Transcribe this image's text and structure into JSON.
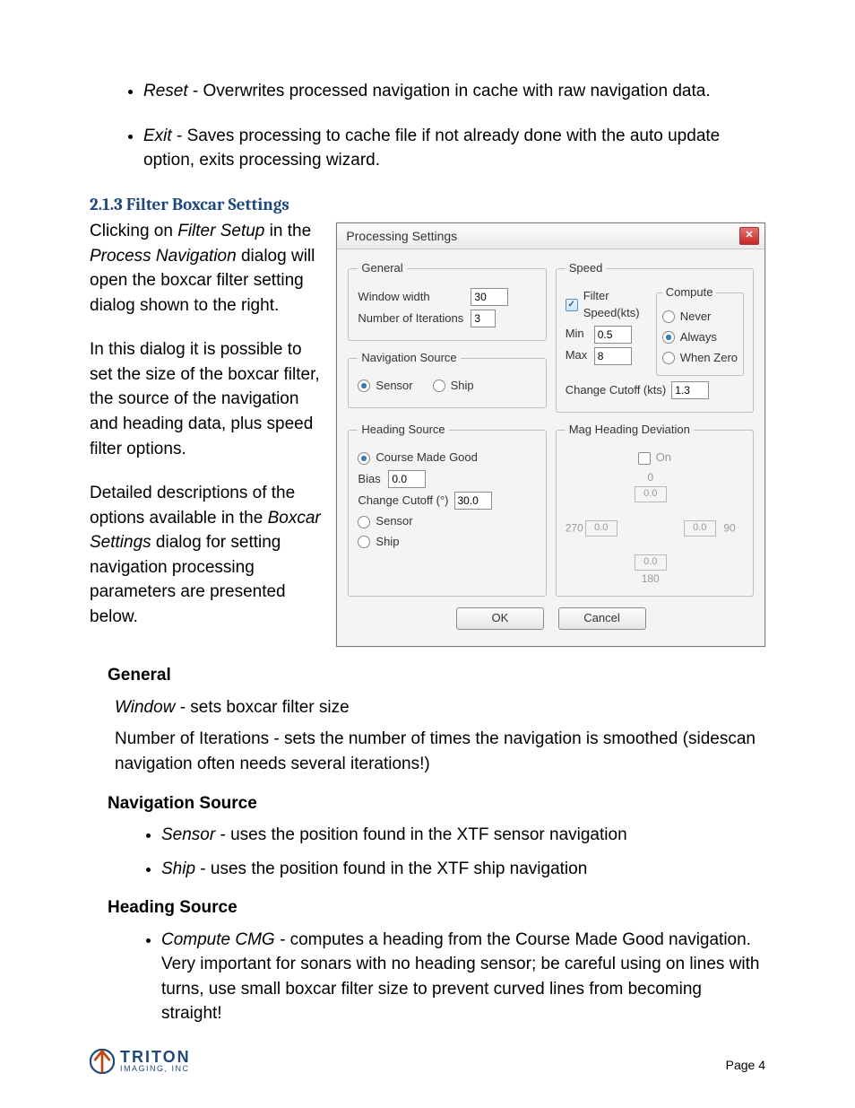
{
  "bullets_top": [
    {
      "term": "Reset",
      "desc": " - Overwrites processed navigation in cache with raw navigation data."
    },
    {
      "term": "Exit",
      "desc": " - Saves processing to cache file if not already done with the auto update option, exits processing wizard."
    }
  ],
  "section_number": "2.1.3 Filter Boxcar Settings",
  "para1a": "Clicking on ",
  "para1b": "Filter Setup",
  "para1c": " in the ",
  "para1d": "Process Navigation",
  "para1e": " dialog will open the boxcar filter setting dialog shown to the right.",
  "para2": "In this dialog it is possible to set the size of the boxcar filter, the source of the navigation and heading data, plus speed filter options.",
  "para3a": "Detailed descriptions of the options available in the ",
  "para3b": "Boxcar Settings",
  "para3c": " dialog for setting navigation processing parameters are presented below.",
  "dialog": {
    "title": "Processing Settings",
    "general": {
      "legend": "General",
      "window_label": "Window width",
      "window_value": "30",
      "iter_label": "Number of Iterations",
      "iter_value": "3"
    },
    "navsource": {
      "legend": "Navigation Source",
      "sensor": "Sensor",
      "ship": "Ship"
    },
    "speed": {
      "legend": "Speed",
      "filter_label": "Filter Speed(kts)",
      "min_label": "Min",
      "min_value": "0.5",
      "max_label": "Max",
      "max_value": "8",
      "cutoff_label": "Change Cutoff (kts)",
      "cutoff_value": "1.3",
      "compute": {
        "legend": "Compute",
        "never": "Never",
        "always": "Always",
        "whenzero": "When Zero"
      }
    },
    "heading": {
      "legend": "Heading Source",
      "cmg": "Course Made Good",
      "bias_label": "Bias",
      "bias_value": "0.0",
      "cutoff_label": "Change Cutoff (°)",
      "cutoff_value": "30.0",
      "sensor": "Sensor",
      "ship": "Ship"
    },
    "mag": {
      "legend": "Mag Heading Deviation",
      "on": "On",
      "n": "0",
      "s": "180",
      "w": "270",
      "e": "90",
      "val": "0.0"
    },
    "ok": "OK",
    "cancel": "Cancel"
  },
  "sub_general": "General",
  "def_window_a": "Window",
  "def_window_b": " - sets boxcar filter size",
  "def_iter": "Number of Iterations - sets the number of times the navigation is smoothed (sidescan navigation often needs several iterations!)",
  "sub_nav": "Navigation Source",
  "nav_items": [
    {
      "term": "Sensor",
      "desc": " - uses the position found in the XTF sensor navigation"
    },
    {
      "term": "Ship",
      "desc": " - uses the position found in the XTF ship navigation"
    }
  ],
  "sub_head": "Heading Source",
  "head_items": [
    {
      "term": "Compute CMG - ",
      "desc": "computes a heading from the Course Made Good navigation.  Very important for sonars with no heading sensor; be careful using on lines with turns, use small boxcar filter size to prevent curved lines from becoming straight!"
    }
  ],
  "footer": {
    "brand1": "TRITON",
    "brand2": "IMAGING, INC",
    "page": "Page 4"
  }
}
